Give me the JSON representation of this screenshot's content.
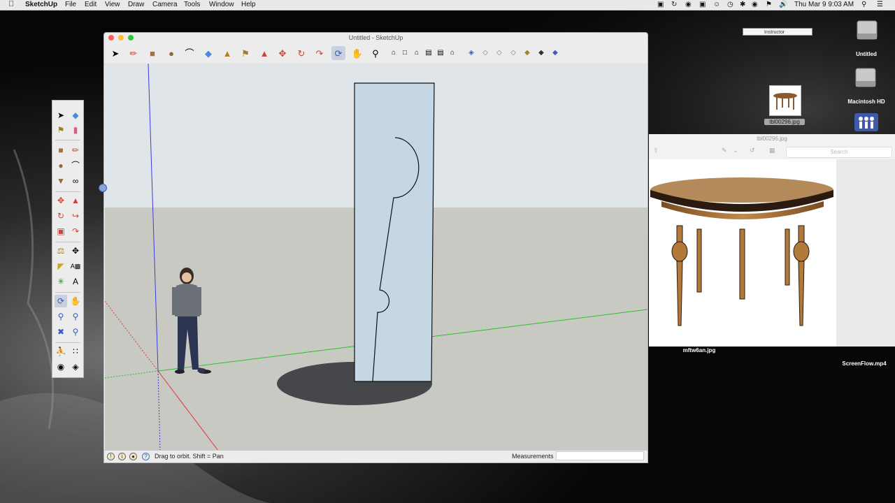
{
  "menubar": {
    "app_name": "SketchUp",
    "menus": [
      "File",
      "Edit",
      "View",
      "Draw",
      "Camera",
      "Tools",
      "Window",
      "Help"
    ],
    "clock": "Thu Mar 9  9:03 AM"
  },
  "window": {
    "title": "Untitled - SketchUp"
  },
  "statusbar": {
    "hint": "Drag to orbit.  Shift = Pan",
    "measurements_label": "Measurements",
    "measurements_value": ""
  },
  "desktop": {
    "instructor_label": "Instructor",
    "icons": {
      "untitled": "Untitled",
      "macintosh_hd": "Macintosh HD",
      "tbl_file": "tbl00296.jpg",
      "mftw_file": "mftw6an.jpg",
      "screenflow_file": "ScreenFlow.mp4"
    }
  },
  "preview": {
    "title": "tbl00296.jpg",
    "search_placeholder": "Search"
  },
  "colors": {
    "sky": "#dde3e6",
    "ground": "#c9c9c4",
    "shape_fill": "#c5d6e5",
    "shadow": "#45474b",
    "axis_blue": "#3b3bd6",
    "axis_green": "#2fbb2f",
    "axis_red": "#d63b3b"
  },
  "icons": {
    "select": "arrow-cursor-icon",
    "orbit": "orbit-icon",
    "pan": "pan-hand-icon",
    "zoom": "zoom-icon"
  }
}
